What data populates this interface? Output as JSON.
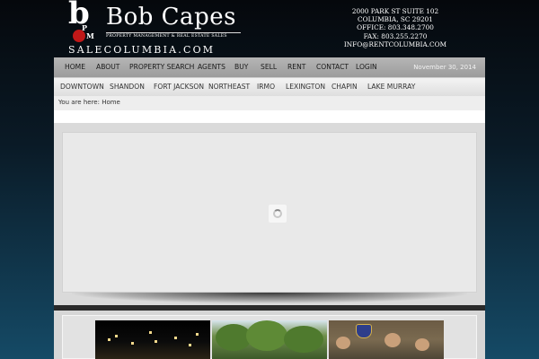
{
  "brand": {
    "mark_letter": "b",
    "mark_p": "P",
    "mark_m": "M",
    "name": "Bob Capes",
    "tagline": "PROPERTY MANAGEMENT & REAL ESTATE SALES",
    "domain": "SALECOLUMBIA.COM",
    "accent_color": "#c01818"
  },
  "contact": {
    "address1": "2000 PARK ST SUITE 102",
    "address2": "COLUMBIA, SC 29201",
    "office": "OFFICE: 803.348.2700",
    "fax": "FAX: 803.255.2270",
    "email": "INFO@RENTCOLUMBIA.COM"
  },
  "main_nav": {
    "items": [
      {
        "label": "HOME"
      },
      {
        "label": "ABOUT"
      },
      {
        "label": "PROPERTY SEARCH"
      },
      {
        "label": "AGENTS"
      },
      {
        "label": "BUY"
      },
      {
        "label": "SELL"
      },
      {
        "label": "RENT"
      },
      {
        "label": "CONTACT"
      },
      {
        "label": "LOGIN"
      }
    ],
    "date": "November 30, 2014"
  },
  "sub_nav": {
    "items": [
      {
        "label": "DOWNTOWN"
      },
      {
        "label": "SHANDON"
      },
      {
        "label": "FORT JACKSON"
      },
      {
        "label": "NORTHEAST"
      },
      {
        "label": "IRMO"
      },
      {
        "label": "LEXINGTON"
      },
      {
        "label": "CHAPIN"
      },
      {
        "label": "LAKE MURRAY"
      }
    ]
  },
  "breadcrumb": {
    "text": "You are here: Home"
  },
  "slider": {
    "state": "loading",
    "icon": "loading-spinner-icon"
  },
  "gallery": {
    "thumbs": [
      {
        "icon": "city-night-photo"
      },
      {
        "icon": "trees-photo"
      },
      {
        "icon": "soldiers-photo"
      }
    ]
  }
}
